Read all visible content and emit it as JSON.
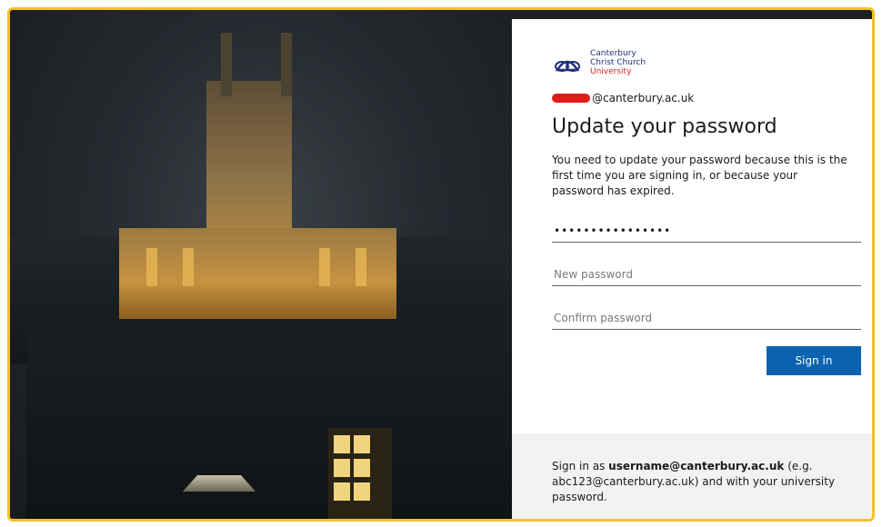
{
  "branding": {
    "logo_line1": "Canterbury",
    "logo_line2": "Christ Church",
    "logo_line3": "University",
    "primary_color": "#21307b",
    "accent_color": "#d8202a"
  },
  "identity": {
    "email_suffix": "@canterbury.ac.uk"
  },
  "form": {
    "title": "Update your password",
    "description": "You need to update your password because this is the first time you are signing in, or because your password has expired.",
    "current_password_mask": "••••••••••••••••",
    "new_password_placeholder": "New password",
    "confirm_password_placeholder": "Confirm password",
    "submit_label": "Sign in",
    "button_color": "#0b63b0"
  },
  "footer": {
    "prefix": "Sign in as ",
    "bold_username": "username@canterbury.ac.uk",
    "suffix": " (e.g. abc123@canterbury.ac.uk) and with your university password."
  }
}
